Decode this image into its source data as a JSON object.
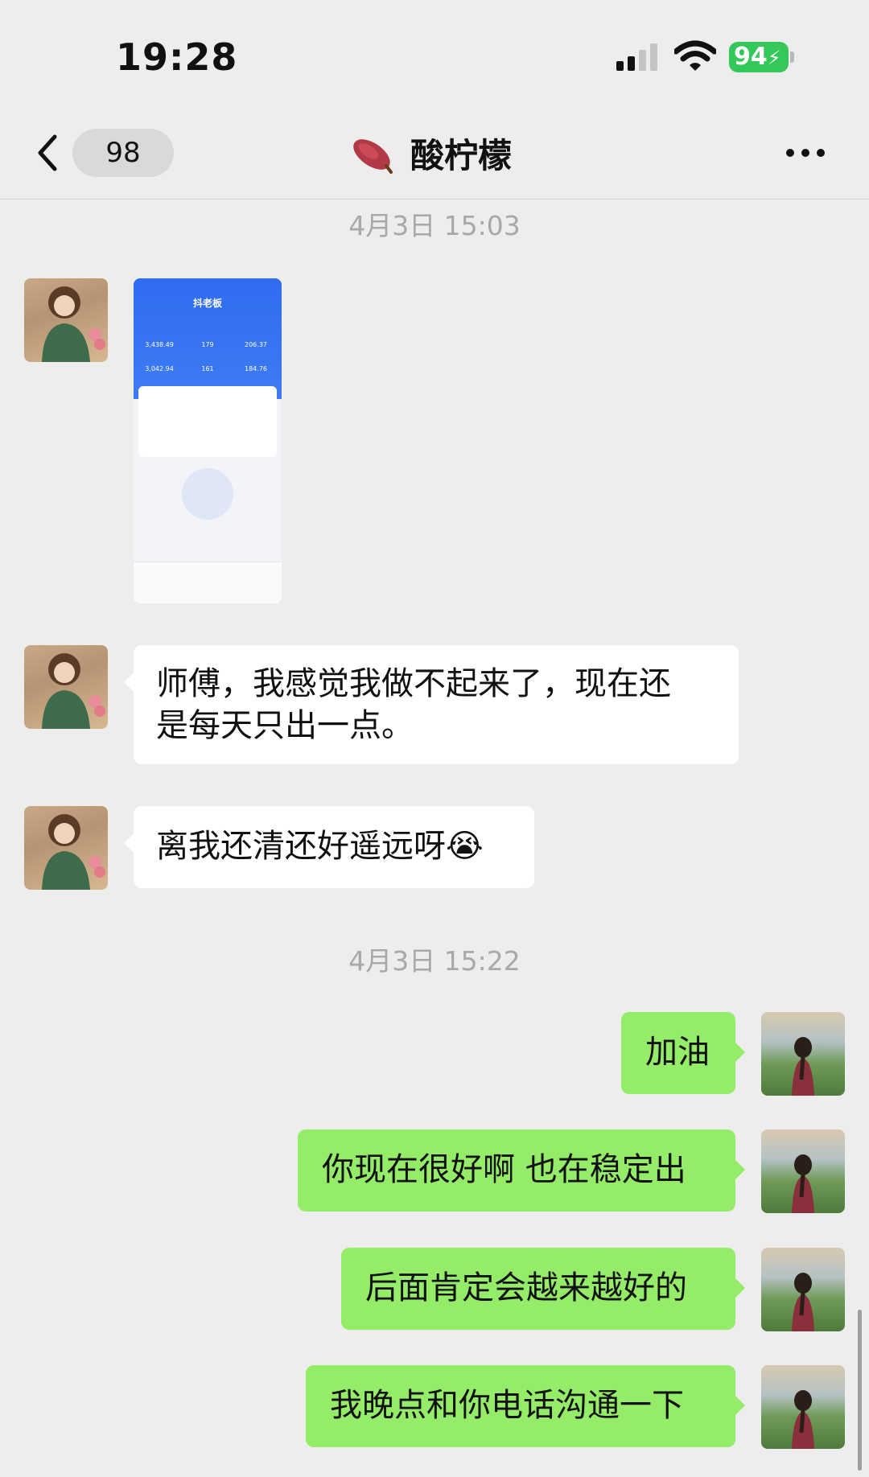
{
  "status_bar": {
    "time": "19:28",
    "battery_percent": "94"
  },
  "nav": {
    "unread_count": "98",
    "contact_name": "酸柠檬",
    "title_icon": "sweet-potato-emoji",
    "back_icon": "chevron-left-icon",
    "more_icon": "more-dots-icon"
  },
  "timestamps": [
    "4月3日 15:03",
    "4月3日 15:22"
  ],
  "messages": {
    "left_1_text": "师傅，我感觉我做不起来了，现在还是每天只出一点。",
    "left_1_line1": "师傅，我感觉我做不起来了，现在还",
    "left_1_line2": "是每天只出一点。",
    "left_2_text": "离我还清还好遥远呀",
    "left_2_emoji": "😭",
    "right_1": "加油",
    "right_2": "你现在很好啊 也在稳定出",
    "right_3": "后面肯定会越来越好的",
    "right_4": "我晚点和你电话沟通一下"
  },
  "thumbnail": {
    "title": "抖老板",
    "stats": [
      "3,438.49",
      "179",
      "206.37",
      "3,042.94",
      "161",
      "184.76"
    ]
  },
  "colors": {
    "background": "#ededed",
    "incoming_bubble": "#ffffff",
    "outgoing_bubble": "#95ec69",
    "battery": "#34c759",
    "timestamp": "#a8a8a8"
  }
}
